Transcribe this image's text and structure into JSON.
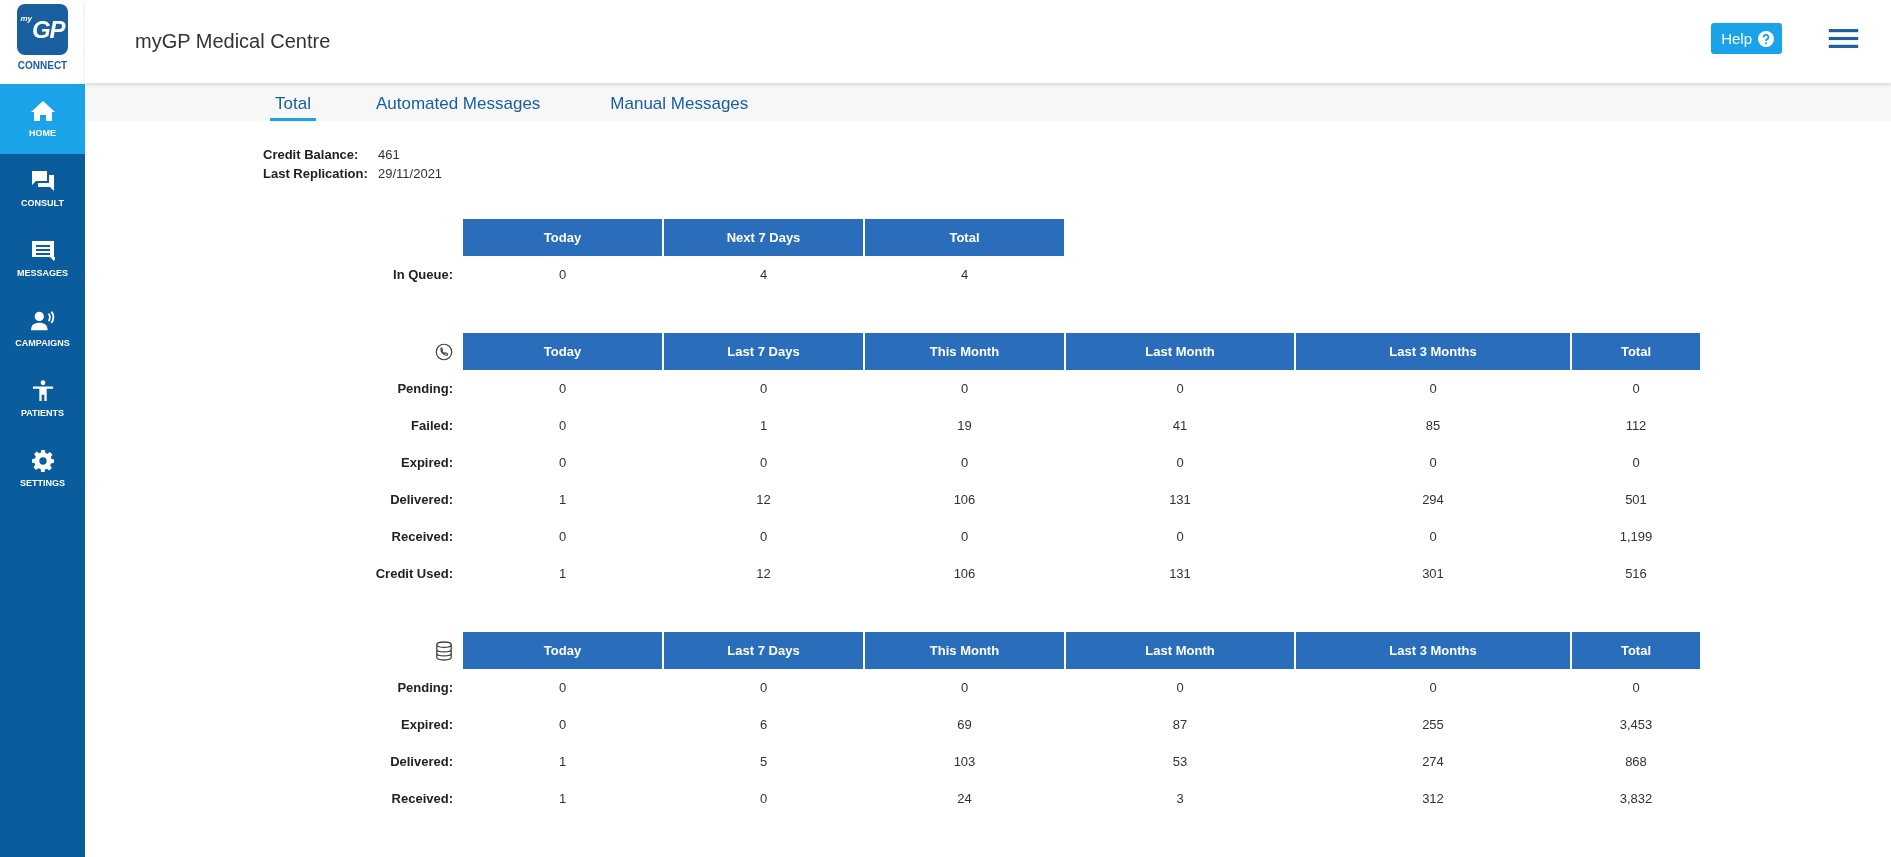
{
  "logo": {
    "superscript": "my",
    "mark": "GP",
    "caption": "CONNECT"
  },
  "header": {
    "title": "myGP Medical Centre",
    "help": "Help"
  },
  "sidebar": {
    "items": [
      {
        "kind": "home",
        "label": "HOME",
        "selected": true
      },
      {
        "kind": "consult",
        "label": "CONSULT",
        "selected": false
      },
      {
        "kind": "messages",
        "label": "MESSAGES",
        "selected": false
      },
      {
        "kind": "campaigns",
        "label": "CAMPAIGNS",
        "selected": false
      },
      {
        "kind": "patients",
        "label": "PATIENTS",
        "selected": false
      },
      {
        "kind": "settings",
        "label": "SETTINGS",
        "selected": false
      }
    ]
  },
  "tabs": [
    {
      "label": "Total",
      "selected": true
    },
    {
      "label": "Automated Messages",
      "selected": false
    },
    {
      "label": "Manual Messages",
      "selected": false
    }
  ],
  "info": [
    {
      "label": "Credit Balance:",
      "value": "461"
    },
    {
      "label": "Last Replication:",
      "value": "29/11/2021"
    }
  ],
  "tables": [
    {
      "kind": "plain",
      "columns": [
        "Today",
        "Next 7 Days",
        "Total"
      ],
      "rows": [
        {
          "label": "In Queue:",
          "cells": [
            "0",
            "4",
            "4"
          ]
        }
      ]
    },
    {
      "kind": "phone",
      "columns": [
        "Today",
        "Last 7 Days",
        "This Month",
        "Last Month",
        "Last 3 Months",
        "Total"
      ],
      "rows": [
        {
          "label": "Pending:",
          "cells": [
            "0",
            "0",
            "0",
            "0",
            "0",
            "0"
          ]
        },
        {
          "label": "Failed:",
          "cells": [
            "0",
            "1",
            "19",
            "41",
            "85",
            "112"
          ]
        },
        {
          "label": "Expired:",
          "cells": [
            "0",
            "0",
            "0",
            "0",
            "0",
            "0"
          ]
        },
        {
          "label": "Delivered:",
          "cells": [
            "1",
            "12",
            "106",
            "131",
            "294",
            "501"
          ]
        },
        {
          "label": "Received:",
          "cells": [
            "0",
            "0",
            "0",
            "0",
            "0",
            "1,199"
          ]
        },
        {
          "label": "Credit Used:",
          "cells": [
            "1",
            "12",
            "106",
            "131",
            "301",
            "516"
          ]
        }
      ]
    },
    {
      "kind": "database",
      "columns": [
        "Today",
        "Last 7 Days",
        "This Month",
        "Last Month",
        "Last 3 Months",
        "Total"
      ],
      "rows": [
        {
          "label": "Pending:",
          "cells": [
            "0",
            "0",
            "0",
            "0",
            "0",
            "0"
          ]
        },
        {
          "label": "Expired:",
          "cells": [
            "0",
            "6",
            "69",
            "87",
            "255",
            "3,453"
          ]
        },
        {
          "label": "Delivered:",
          "cells": [
            "1",
            "5",
            "103",
            "53",
            "274",
            "868"
          ]
        },
        {
          "label": "Received:",
          "cells": [
            "1",
            "0",
            "24",
            "3",
            "312",
            "3,832"
          ]
        }
      ]
    }
  ]
}
